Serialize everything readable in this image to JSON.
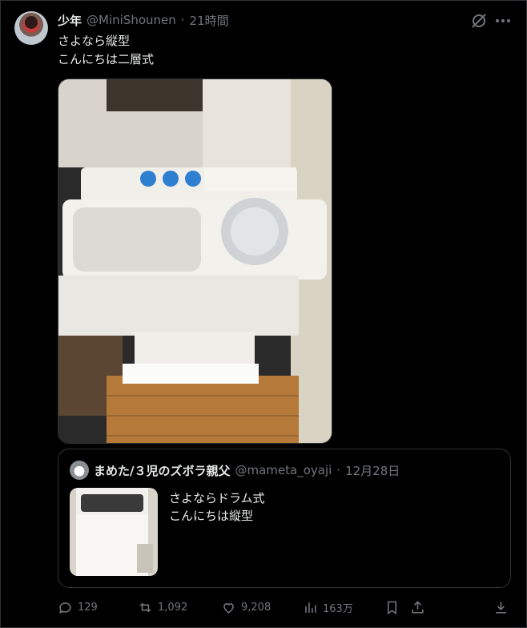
{
  "tweet": {
    "display_name": "少年",
    "handle": "@MiniShounen",
    "separator": "·",
    "time": "21時間",
    "text_line1": "さよなら縦型",
    "text_line2": "こんにちは二層式"
  },
  "quoted": {
    "display_name": "まめた/３児のズボラ親父",
    "handle": "@mameta_oyaji",
    "separator": "·",
    "date": "12月28日",
    "text_line1": "さよならドラム式",
    "text_line2": "こんにちは縦型"
  },
  "actions": {
    "replies": "129",
    "reposts": "1,092",
    "likes": "9,208",
    "views": "163万"
  },
  "colors": {
    "background": "#000000",
    "text": "#e7e9ea",
    "muted": "#71767b",
    "border": "#2f3336"
  },
  "icons": [
    "grok-icon",
    "more-icon",
    "reply-icon",
    "repost-icon",
    "like-icon",
    "views-icon",
    "bookmark-icon",
    "share-icon",
    "download-icon"
  ]
}
